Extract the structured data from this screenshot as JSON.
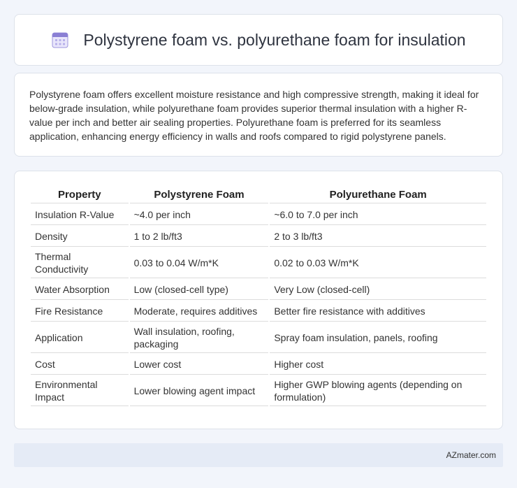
{
  "header": {
    "title": "Polystyrene foam vs. polyurethane foam for insulation",
    "icon": "calendar-icon"
  },
  "summary": {
    "text": "Polystyrene foam offers excellent moisture resistance and high compressive strength, making it ideal for below-grade insulation, while polyurethane foam provides superior thermal insulation with a higher R-value per inch and better air sealing properties. Polyurethane foam is preferred for its seamless application, enhancing energy efficiency in walls and roofs compared to rigid polystyrene panels."
  },
  "table": {
    "headers": [
      "Property",
      "Polystyrene Foam",
      "Polyurethane Foam"
    ],
    "rows": [
      [
        "Insulation R-Value",
        "~4.0 per inch",
        "~6.0 to 7.0 per inch"
      ],
      [
        "Density",
        "1 to 2 lb/ft3",
        "2 to 3 lb/ft3"
      ],
      [
        "Thermal Conductivity",
        "0.03 to 0.04 W/m*K",
        "0.02 to 0.03 W/m*K"
      ],
      [
        "Water Absorption",
        "Low (closed-cell type)",
        "Very Low (closed-cell)"
      ],
      [
        "Fire Resistance",
        "Moderate, requires additives",
        "Better fire resistance with additives"
      ],
      [
        "Application",
        "Wall insulation, roofing, packaging",
        "Spray foam insulation, panels, roofing"
      ],
      [
        "Cost",
        "Lower cost",
        "Higher cost"
      ],
      [
        "Environmental Impact",
        "Lower blowing agent impact",
        "Higher GWP blowing agents (depending on formulation)"
      ]
    ]
  },
  "footer": {
    "text": "AZmater.com"
  },
  "colors": {
    "background": "#f2f5fb",
    "footer_bar": "#e5ebf6",
    "icon_accent": "#8a7fd4"
  }
}
